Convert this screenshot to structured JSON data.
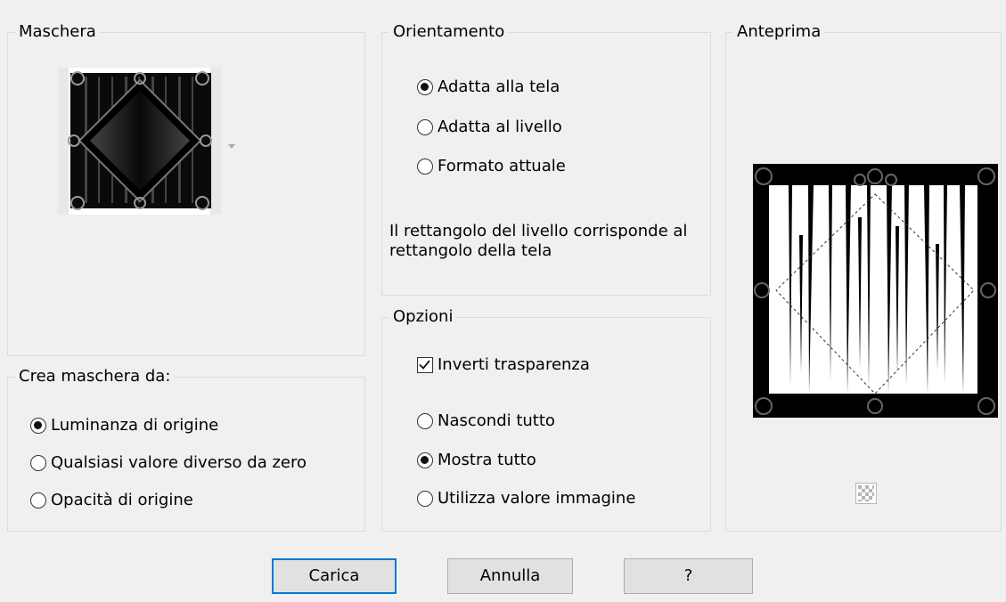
{
  "mask_group": {
    "legend": "Maschera",
    "thumbnail_icon": "mask-thumbnail-image",
    "dropdown_icon": "chevron-down-icon"
  },
  "source_group": {
    "legend": "Crea maschera da:",
    "options": [
      {
        "label": "Luminanza di origine",
        "selected": true
      },
      {
        "label": "Qualsiasi valore diverso da zero",
        "selected": false
      },
      {
        "label": "Opacità di origine",
        "selected": false
      }
    ]
  },
  "orientation_group": {
    "legend": "Orientamento",
    "options": [
      {
        "label": "Adatta alla tela",
        "selected": true
      },
      {
        "label": "Adatta al livello",
        "selected": false
      },
      {
        "label": "Formato attuale",
        "selected": false
      }
    ],
    "description": "Il rettangolo del livello corrisponde al rettangolo della tela"
  },
  "options_group": {
    "legend": "Opzioni",
    "invert_label": "Inverti trasparenza",
    "invert_checked": true,
    "options": [
      {
        "label": "Nascondi tutto",
        "selected": false
      },
      {
        "label": "Mostra tutto",
        "selected": true
      },
      {
        "label": "Utilizza valore immagine",
        "selected": false
      }
    ]
  },
  "preview_group": {
    "legend": "Anteprima",
    "preview_icon": "mask-preview-image",
    "transparency_icon": "transparency-checker-icon"
  },
  "buttons": {
    "load": "Carica",
    "cancel": "Annulla",
    "help": "?"
  }
}
